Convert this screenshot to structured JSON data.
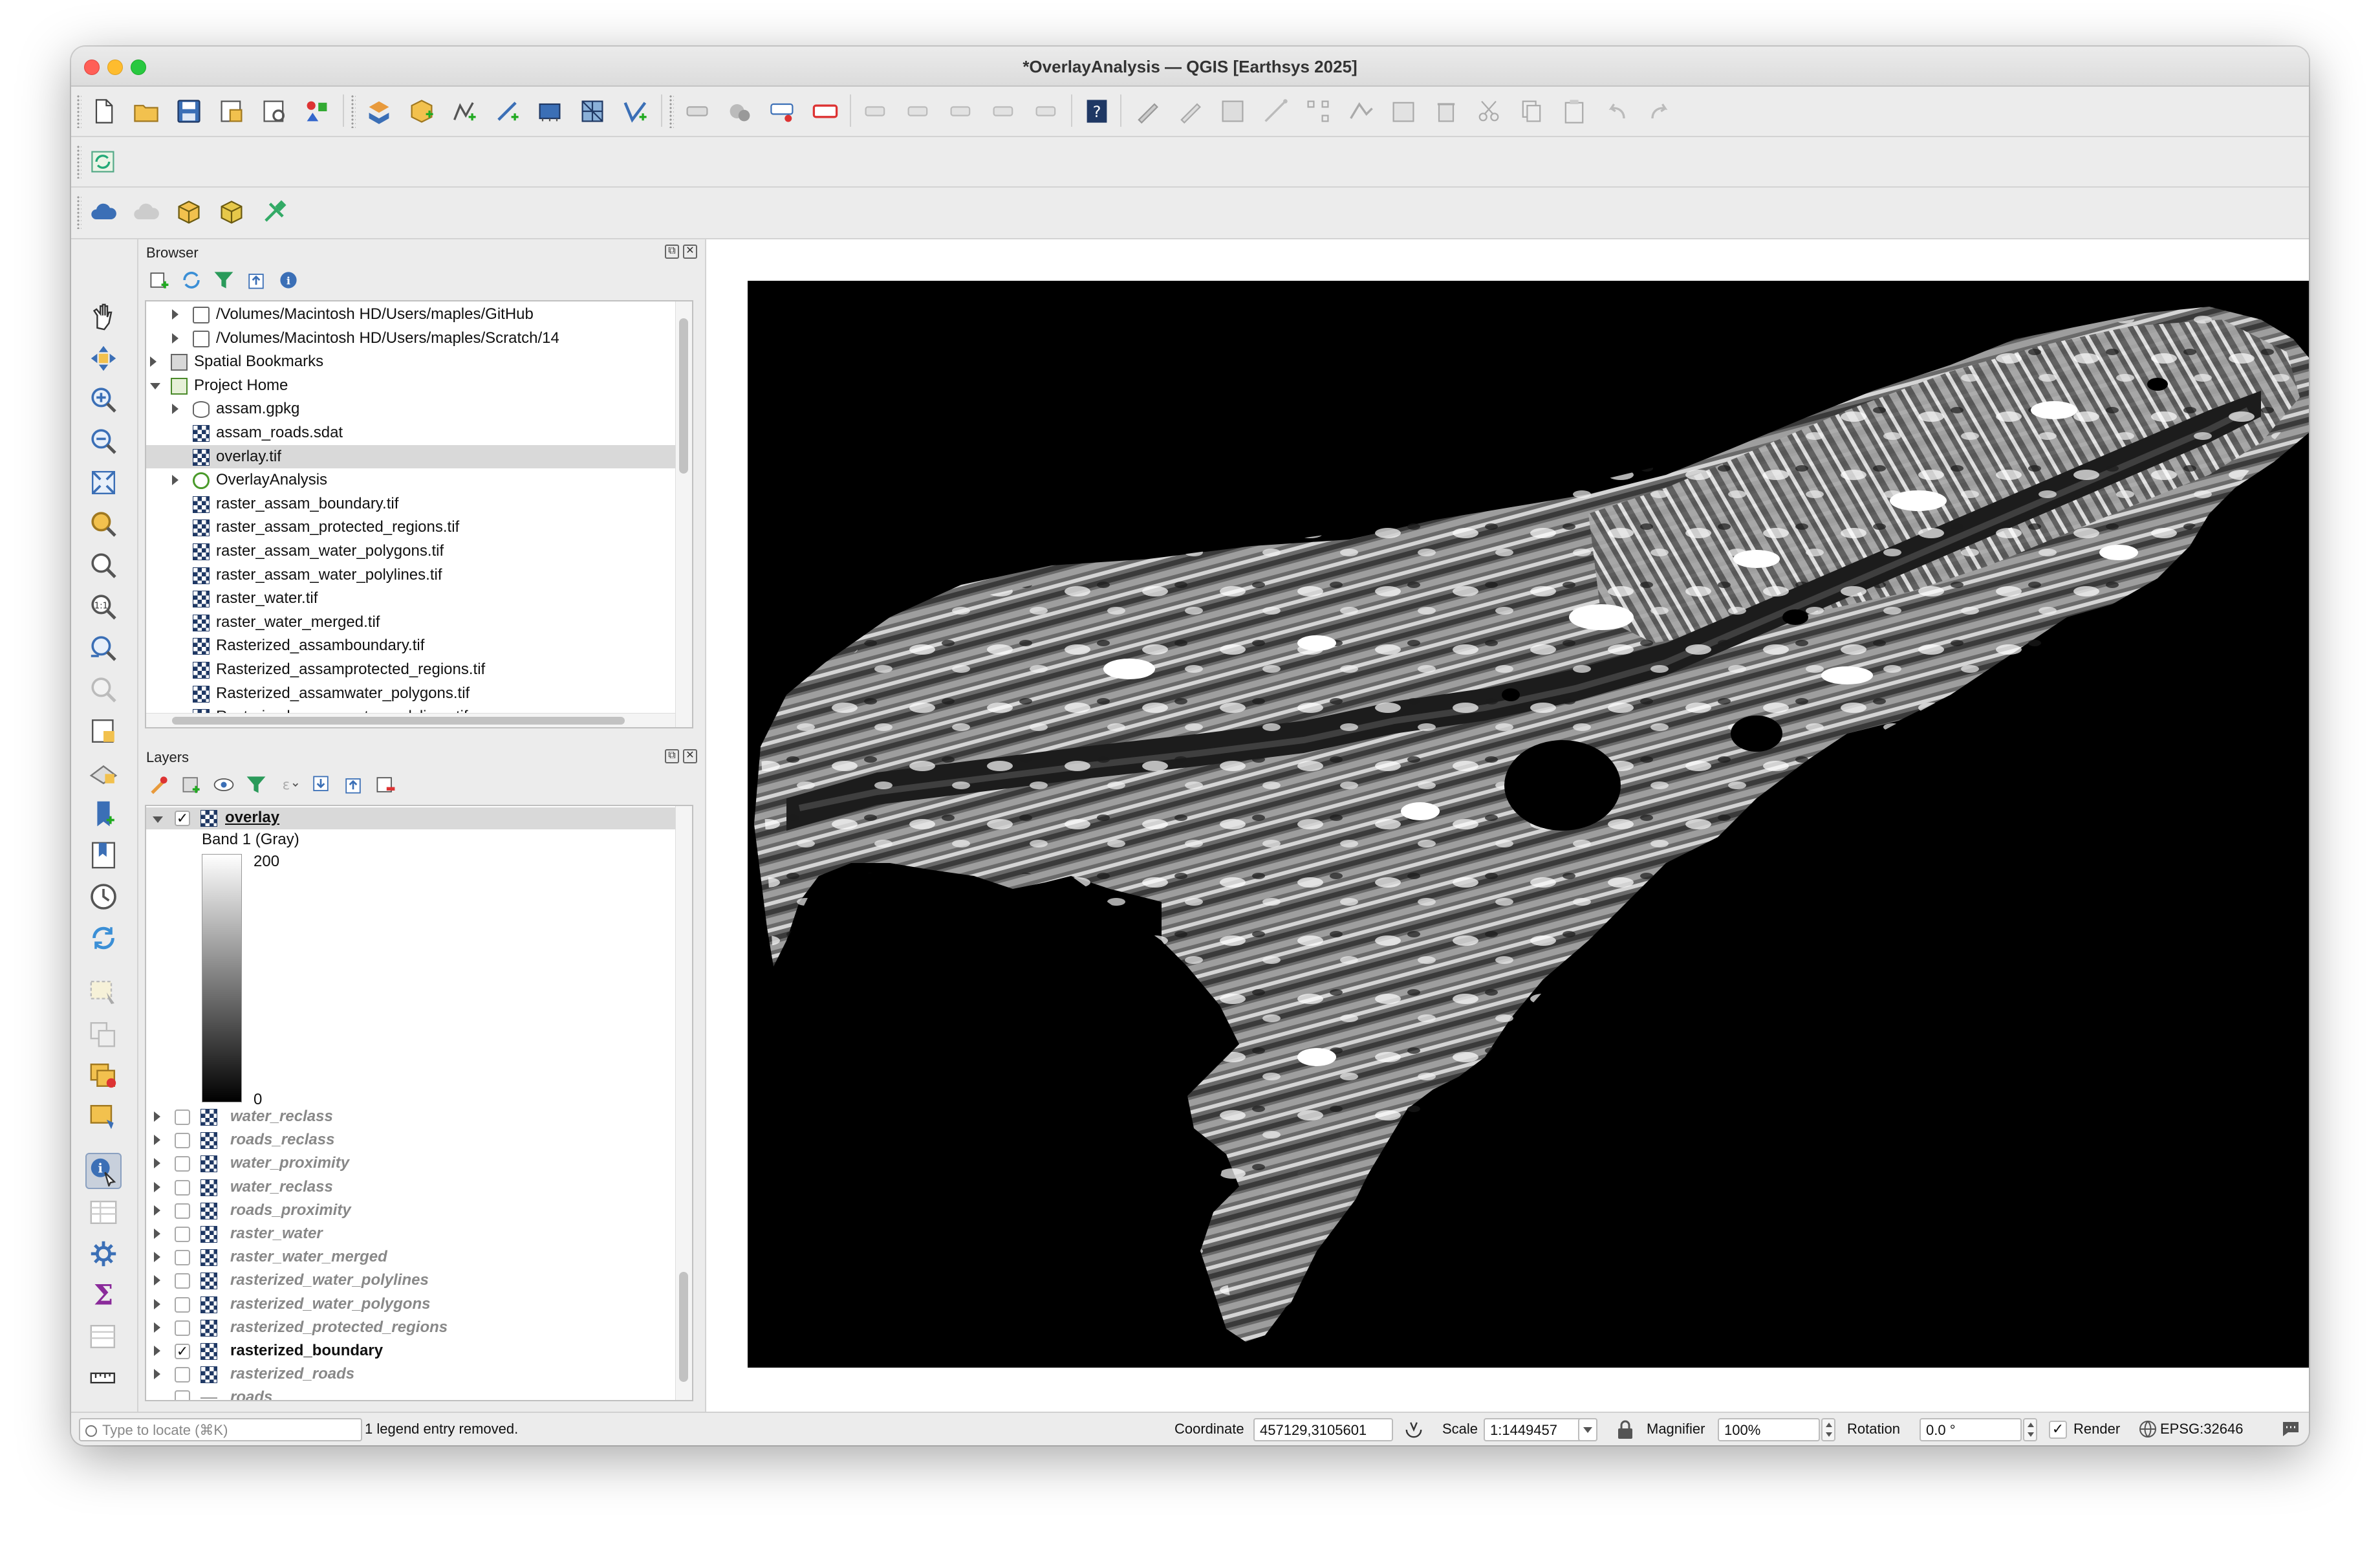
{
  "window": {
    "title": "*OverlayAnalysis — QGIS [Earthsys 2025]"
  },
  "browser": {
    "title": "Browser",
    "items": [
      {
        "label": "/Volumes/Macintosh HD/Users/maples/GitHub",
        "icon": "folder-icon"
      },
      {
        "label": "/Volumes/Macintosh HD/Users/maples/Scratch/14",
        "icon": "folder-icon"
      },
      {
        "label": "Spatial Bookmarks",
        "icon": "bookmark-icon"
      },
      {
        "label": "Project Home",
        "icon": "project-home-icon"
      },
      {
        "label": "assam.gpkg",
        "icon": "geopackage-icon"
      },
      {
        "label": "assam_roads.sdat",
        "icon": "raster-icon"
      },
      {
        "label": "overlay.tif",
        "icon": "raster-icon"
      },
      {
        "label": "OverlayAnalysis",
        "icon": "qgis-project-icon"
      },
      {
        "label": "raster_assam_boundary.tif",
        "icon": "raster-icon"
      },
      {
        "label": "raster_assam_protected_regions.tif",
        "icon": "raster-icon"
      },
      {
        "label": "raster_assam_water_polygons.tif",
        "icon": "raster-icon"
      },
      {
        "label": "raster_assam_water_polylines.tif",
        "icon": "raster-icon"
      },
      {
        "label": "raster_water.tif",
        "icon": "raster-icon"
      },
      {
        "label": "raster_water_merged.tif",
        "icon": "raster-icon"
      },
      {
        "label": "Rasterized_assamboundary.tif",
        "icon": "raster-icon"
      },
      {
        "label": "Rasterized_assamprotected_regions.tif",
        "icon": "raster-icon"
      },
      {
        "label": "Rasterized_assamwater_polygons.tif",
        "icon": "raster-icon"
      },
      {
        "label": "Rasterized_assamwater_polylines.tif",
        "icon": "raster-icon"
      }
    ]
  },
  "layers": {
    "title": "Layers",
    "active": {
      "label": "overlay",
      "band": "Band 1 (Gray)",
      "max": "200",
      "min": "0"
    },
    "items": [
      {
        "label": "water_reclass",
        "checked": false
      },
      {
        "label": "roads_reclass",
        "checked": false
      },
      {
        "label": "water_proximity",
        "checked": false
      },
      {
        "label": "water_reclass",
        "checked": false
      },
      {
        "label": "roads_proximity",
        "checked": false
      },
      {
        "label": "raster_water",
        "checked": false
      },
      {
        "label": "raster_water_merged",
        "checked": false
      },
      {
        "label": "rasterized_water_polylines",
        "checked": false
      },
      {
        "label": "rasterized_water_polygons",
        "checked": false
      },
      {
        "label": "rasterized_protected_regions",
        "checked": false
      },
      {
        "label": "rasterized_boundary",
        "checked": true
      },
      {
        "label": "rasterized_roads",
        "checked": false
      },
      {
        "label": "roads",
        "checked": false
      }
    ]
  },
  "status": {
    "locate_placeholder": "Type to locate (⌘K)",
    "message": "1 legend entry removed.",
    "coordinate_label": "Coordinate",
    "coordinate_value": "457129,3105601",
    "scale_label": "Scale",
    "scale_value": "1:1449457",
    "magnifier_label": "Magnifier",
    "magnifier_value": "100%",
    "rotation_label": "Rotation",
    "rotation_value": "0.0 °",
    "render_label": "Render",
    "render_checked": true,
    "crs": "EPSG:32646"
  },
  "colors": {
    "accent": "#1f3864",
    "map_background": "#000000"
  }
}
